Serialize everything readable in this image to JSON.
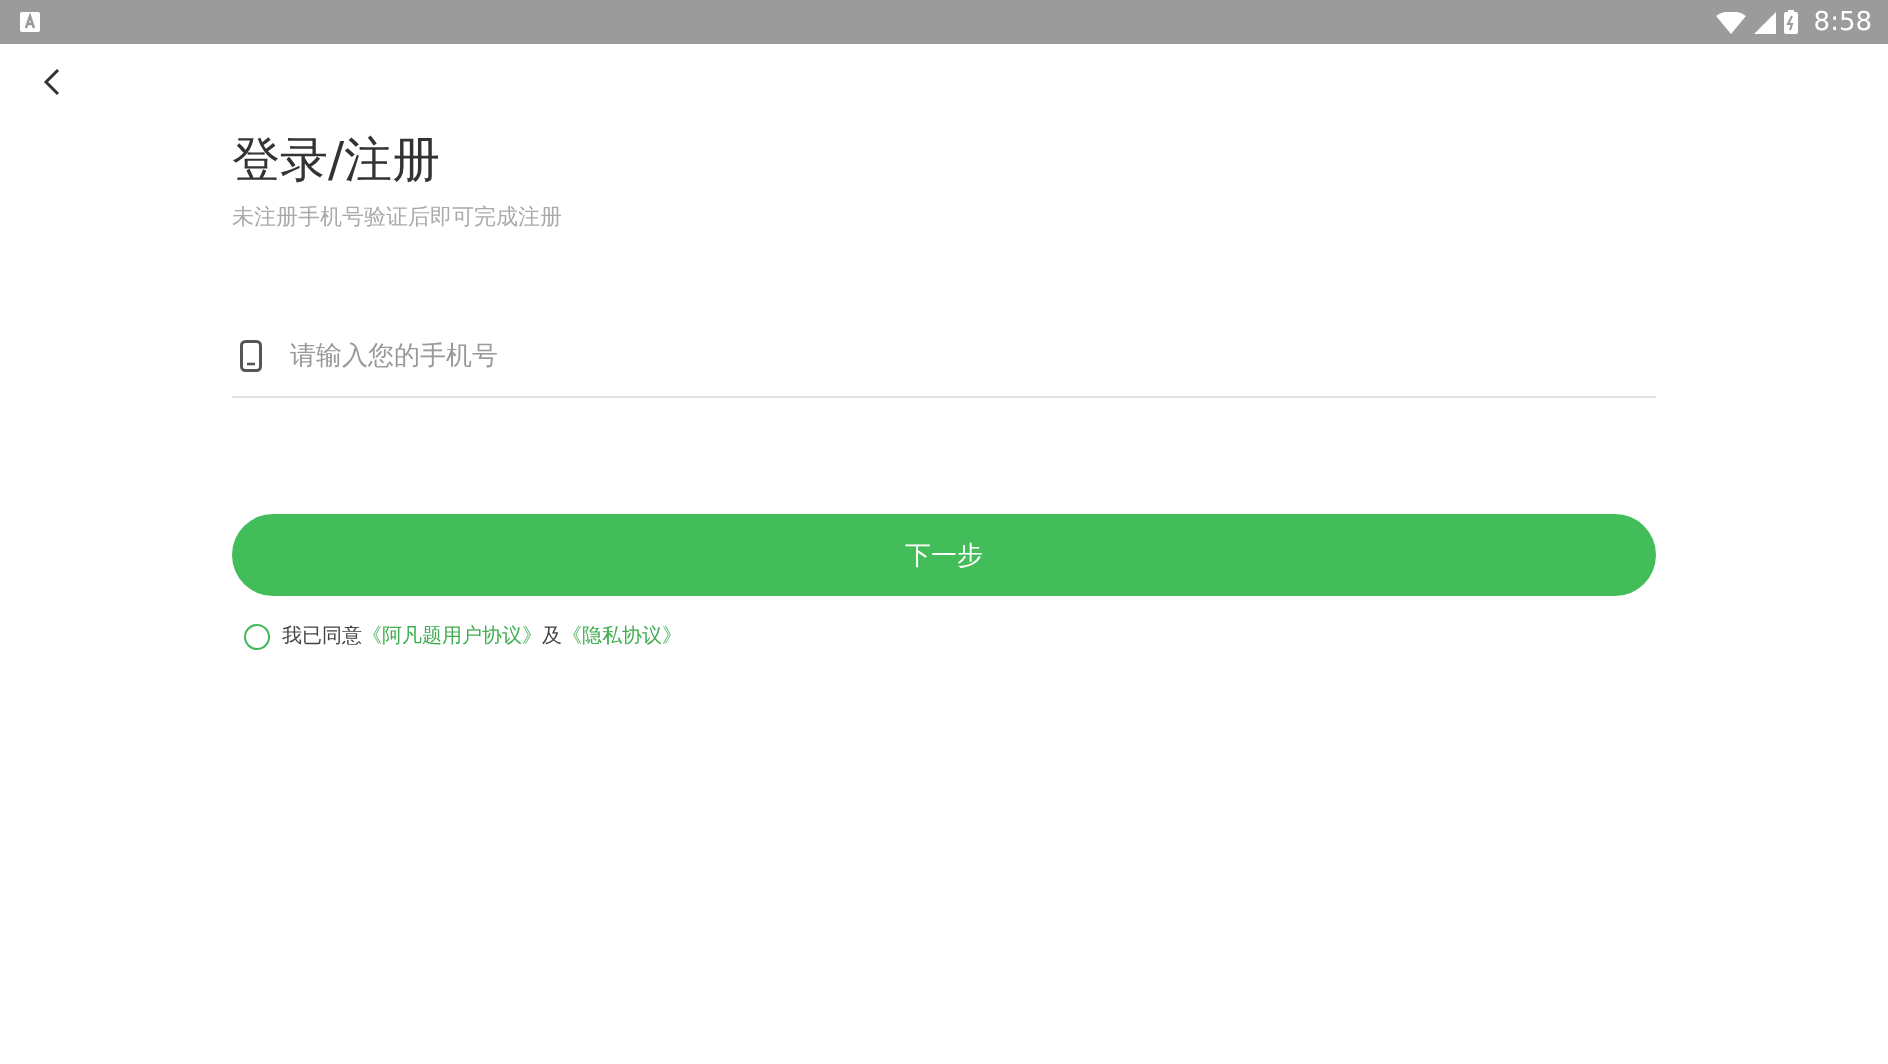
{
  "status_bar": {
    "time": "8:58"
  },
  "title": "登录/注册",
  "subtitle": "未注册手机号验证后即可完成注册",
  "phone_field": {
    "placeholder": "请输入您的手机号"
  },
  "next_button": "下一步",
  "agreement": {
    "checked": false,
    "parts": [
      {
        "kind": "text",
        "text": "我已同意"
      },
      {
        "kind": "link",
        "text": "《阿凡题用户协议》"
      },
      {
        "kind": "text",
        "text": "及"
      },
      {
        "kind": "link",
        "text": "《隐私协议》"
      }
    ]
  }
}
